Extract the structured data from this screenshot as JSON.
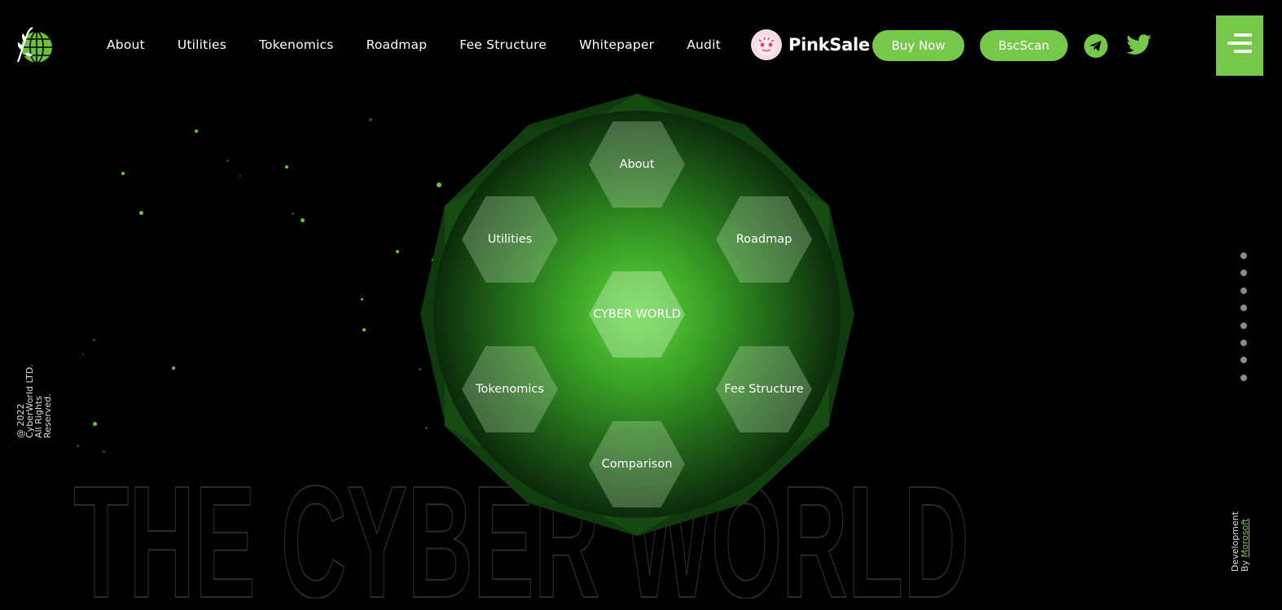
{
  "header": {
    "logo_icon": "globe-leaf-icon",
    "nav": [
      "About",
      "Utilities",
      "Tokenomics",
      "Roadmap",
      "Fee Structure",
      "Whitepaper",
      "Audit"
    ],
    "pinksale_label": "PinkSale",
    "buy_label": "Buy Now",
    "bsc_label": "BscScan",
    "telegram_icon": "telegram-icon",
    "twitter_icon": "twitter-icon",
    "menu_icon": "hamburger-menu-icon"
  },
  "hexagons": {
    "center": "CYBER WORLD",
    "about": "About",
    "utilities": "Utilities",
    "roadmap": "Roadmap",
    "tokenomics": "Tokenomics",
    "fee": "Fee Structure",
    "comparison": "Comparison"
  },
  "hero_text": "THE CYBER WORLD",
  "copyright": {
    "line1": "Reserved.",
    "line2": "All Rights",
    "line3": "CyberWorld LTD.",
    "line4": "@ 2022"
  },
  "credit": {
    "line1": "Development",
    "by": "By ",
    "link": "Morosoft"
  },
  "colors": {
    "accent": "#76c84a",
    "background": "#000000"
  }
}
